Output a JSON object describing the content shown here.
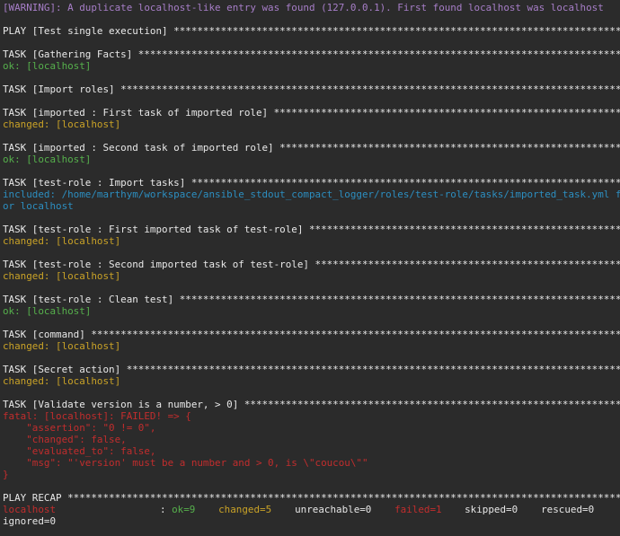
{
  "colors": {
    "background": "#2b2b2b",
    "text": "#e6e6e6",
    "warning": "#a77ec8",
    "ok": "#56b04c",
    "changed": "#c9a227",
    "included": "#2c8ec0",
    "fatal": "#c22d2d"
  },
  "warning": "[WARNING]: A duplicate localhost-like entry was found (127.0.0.1). First found localhost was localhost",
  "play_header": "PLAY [Test single execution] *******************************************************************************************************************",
  "tasks": [
    {
      "header": "TASK [Gathering Facts] *************************************************************************************************************",
      "status_class": "ok",
      "status": [
        "ok: [localhost]"
      ]
    },
    {
      "header": "TASK [Import roles] ****************************************************************************************************************",
      "status_class": "blank",
      "status": []
    },
    {
      "header": "TASK [imported : First task of imported role] **********************************************************************************",
      "status_class": "changed",
      "status": [
        "changed: [localhost]"
      ]
    },
    {
      "header": "TASK [imported : Second task of imported role] *********************************************************************************",
      "status_class": "ok",
      "status": [
        "ok: [localhost]"
      ]
    },
    {
      "header": "TASK [test-role : Import tasks] ********************************************************************************************************",
      "status_class": "included",
      "status": [
        "included: /home/marthym/workspace/ansible_stdout_compact_logger/roles/test-role/tasks/imported_task.yml f",
        "or localhost"
      ]
    },
    {
      "header": "TASK [test-role : First imported task of test-role] ****************************************************************************",
      "status_class": "changed",
      "status": [
        "changed: [localhost]"
      ]
    },
    {
      "header": "TASK [test-role : Second imported task of test-role] ***************************************************************************",
      "status_class": "changed",
      "status": [
        "changed: [localhost]"
      ]
    },
    {
      "header": "TASK [test-role : Clean test] ******************************************************************************************************",
      "status_class": "ok",
      "status": [
        "ok: [localhost]"
      ]
    },
    {
      "header": "TASK [command] *********************************************************************************************************************",
      "status_class": "changed",
      "status": [
        "changed: [localhost]"
      ]
    },
    {
      "header": "TASK [Secret action] ***************************************************************************************************************",
      "status_class": "changed",
      "status": [
        "changed: [localhost]"
      ]
    },
    {
      "header": "TASK [Validate version is a number, > 0] *******************************************************************************************",
      "status_class": "fatal",
      "status": [
        "fatal: [localhost]: FAILED! => {",
        "    \"assertion\": \"0 != 0\",",
        "    \"changed\": false,",
        "    \"evaluated_to\": false,",
        "    \"msg\": \"'version' must be a number and > 0, is \\\"coucou\\\"\"",
        "}"
      ]
    }
  ],
  "recap": {
    "header": "PLAY RECAP *****************************************************************************************************************************",
    "host": "localhost",
    "sep": ": ",
    "ok": "ok=9",
    "changed": "changed=5",
    "unreachable": "unreachable=0",
    "failed": "failed=1",
    "skipped": "skipped=0",
    "rescued": "rescued=0",
    "ignored": "ignored=0"
  }
}
